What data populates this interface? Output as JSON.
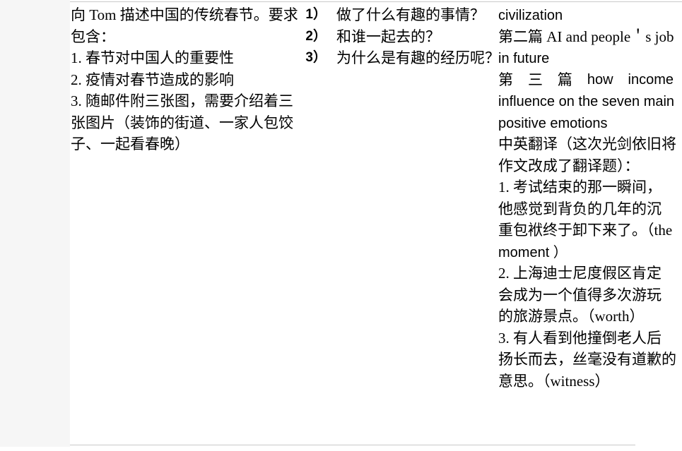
{
  "document": {
    "columns": {
      "left": {
        "lines": [
          "向 Tom 描述中国的传统春节。要求",
          "包含：",
          "1. 春节对中国人的重要性",
          "2. 疫情对春节造成的影响",
          "3. 随邮件附三张图，需要介绍着三",
          "张图片（装饰的街道、一家人包饺",
          "子、一起看春晚）"
        ]
      },
      "middle": {
        "items": [
          {
            "marker": "1）",
            "text": "做了什么有趣的事情？"
          },
          {
            "marker": "2）",
            "text": "和谁一起去的？"
          },
          {
            "marker": "3）",
            "text": "为什么是有趣的经历呢？"
          }
        ]
      },
      "right": {
        "lines": [
          "civilization",
          "第二篇 AI and people＇s job",
          "in future",
          "第　三　篇　how　income",
          "influence on the seven main",
          "positive emotions",
          "中英翻译（这次光剑依旧将",
          "作文改成了翻译题）：",
          "1. 考试结束的那一瞬间，",
          "他感觉到背负的几年的沉",
          "重包袱终于卸下来了。（the",
          "moment ）",
          "2. 上海迪士尼度假区肯定",
          "会成为一个值得多次游玩",
          "的旅游景点。（worth）",
          "3. 有人看到他撞倒老人后",
          "扬长而去，丝毫没有道歉的",
          "意思。（witness）"
        ],
        "justified_line": {
          "segments": [
            "第",
            "三",
            "篇",
            "how",
            "income"
          ]
        }
      }
    },
    "colors": {
      "page_background": "#ffffff",
      "gutter_background": "#f6f6f6",
      "rule": "#c9c9c9",
      "text": "#000000"
    }
  }
}
